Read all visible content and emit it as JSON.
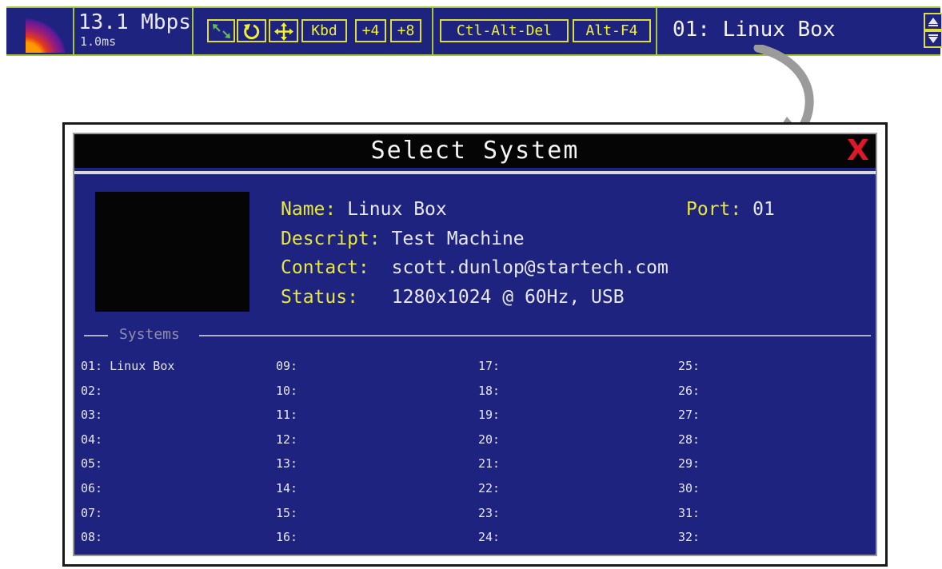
{
  "toolbar": {
    "speed": "13.1 Mbps",
    "latency": "1.0ms",
    "buttons": {
      "kbd": "Kbd",
      "plus4": "+4",
      "plus8": "+8",
      "ctrl_alt_del": "Ctl-Alt-Del",
      "alt_f4": "Alt-F4"
    },
    "current_system": "01: Linux Box"
  },
  "dialog": {
    "title": "Select System",
    "close_label": "X",
    "info": {
      "name_key": "Name:",
      "name_val": "Linux Box",
      "port_key": "Port:",
      "port_val": "01",
      "descript_key": "Descript:",
      "descript_val": "Test Machine",
      "contact_key": "Contact:",
      "contact_val": "scott.dunlop@startech.com",
      "status_key": "Status:",
      "status_val": "1280x1024 @ 60Hz, USB"
    },
    "systems_label": "Systems",
    "systems": [
      [
        "01: Linux Box",
        "02:",
        "03:",
        "04:",
        "05:",
        "06:",
        "07:",
        "08:"
      ],
      [
        "09:",
        "10:",
        "11:",
        "12:",
        "13:",
        "14:",
        "15:",
        "16:"
      ],
      [
        "17:",
        "18:",
        "19:",
        "20:",
        "21:",
        "22:",
        "23:",
        "24:"
      ],
      [
        "25:",
        "26:",
        "27:",
        "28:",
        "29:",
        "30:",
        "31:",
        "32:"
      ]
    ]
  },
  "colors": {
    "panel_blue": "#1e237f",
    "accent_yellow": "#e8e83c",
    "close_red": "#e0162a",
    "toolbar_border": "#a6c638"
  },
  "icons": [
    "logo-icon",
    "select-cursor-icon",
    "refresh-icon",
    "move-icon",
    "scroll-up-icon",
    "scroll-down-icon",
    "callout-arrow-icon",
    "close-icon"
  ]
}
